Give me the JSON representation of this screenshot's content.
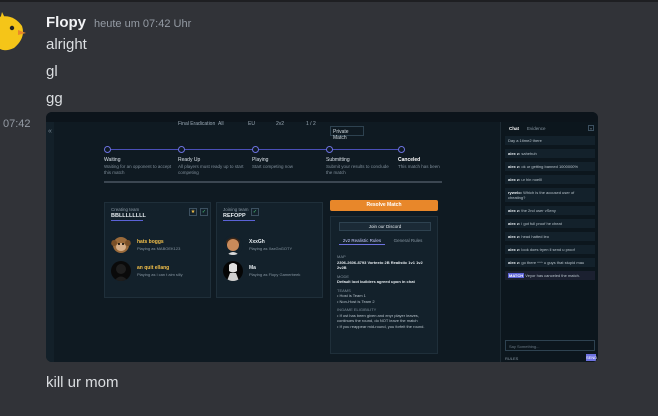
{
  "message": {
    "username": "Flopy",
    "timestamp": "heute um 07:42 Uhr",
    "lines": [
      "alright",
      "gl",
      "gg"
    ],
    "side_timestamp": "07:42",
    "last_line": "kill ur mom"
  },
  "embed": {
    "meta": {
      "col1": "Final Eradication",
      "col2": "All",
      "col3": "EU",
      "col4": "2v2",
      "col5": "1 / 2",
      "private": "Private Match"
    },
    "steps": [
      {
        "title": "Waiting",
        "desc": "Waiting for an opponent to accept this match"
      },
      {
        "title": "Ready Up",
        "desc": "All players must ready up to start competing"
      },
      {
        "title": "Playing",
        "desc": "Start competing now"
      },
      {
        "title": "Submitting",
        "desc": "Submit your results to conclude the match"
      },
      {
        "title": "Canceled",
        "desc": "This match has been"
      }
    ],
    "creating_team": {
      "label": "Creating team",
      "name": "BBLLLLLLLL",
      "players": [
        {
          "name": "hats boggs",
          "desc": "Playing as MABOEK123"
        },
        {
          "name": "an quit ellang",
          "desc": "Playing as i can t aim silly"
        }
      ]
    },
    "joining_team": {
      "label": "Joining team",
      "name": "REFOPP",
      "players": [
        {
          "name": "XxxGh",
          "desc": "Playing as XaxGnGOTY"
        },
        {
          "name": "Ma",
          "desc": "Playing as Flopy Gamerbeek"
        }
      ]
    },
    "resolve_button": "Resolve Match",
    "discord_button": "Join our Discord",
    "rule_tabs": [
      "2v2 Realistic Rules",
      "General Rules"
    ],
    "rules": {
      "map_label": "MAP",
      "map_value": "2306-2606-8793 Vortexto 2B Realistic 1v1 1v2 2v2B",
      "mode_label": "MODE",
      "mode_value": "Default loot builders agreed upon in chat",
      "teams_label": "TEAMS",
      "team_lines": [
        "Host is Team 1",
        "Non-Host is Team 2"
      ],
      "ingame_label": "INGAME ELIGIBILITY",
      "ingame_lines": [
        "If ost has been given and enyr player leaves, continues the round, do NOT leave the match",
        "If you reappear mid-round, you forfeit the round."
      ]
    },
    "chat": {
      "tabs": [
        "Chat",
        "Evidence"
      ],
      "messages": [
        {
          "who": "",
          "text": "Day a 1time2 there"
        },
        {
          "who": "alex z:",
          "text": "sahehuh"
        },
        {
          "who": "alex z:",
          "text": "ok ur getting banned 1000000%"
        },
        {
          "who": "alex z:",
          "text": "ur hin noelll"
        },
        {
          "who": "rywelo:",
          "text": "Which is the accused user of cheating?"
        },
        {
          "who": "alex z:",
          "text": "the 2nd user vSeny"
        },
        {
          "who": "alex z:",
          "text": "i got full proof he cheat"
        },
        {
          "who": "alex z:",
          "text": "head hatted leo"
        },
        {
          "who": "alex z:",
          "text": "look does tryen ll send u proof"
        },
        {
          "who": "alex z:",
          "text": "go there ^^^ u guys that stupid mau"
        },
        {
          "who": "MATCH",
          "text": "Veyor has canceled the match.",
          "system": true
        }
      ],
      "input_placeholder": "Say Something...",
      "rules_label": "RULES",
      "send_label": "SEND"
    }
  },
  "colors": {
    "background": "#313338",
    "accent": "#6d72e0",
    "orange": "#e8872a"
  }
}
